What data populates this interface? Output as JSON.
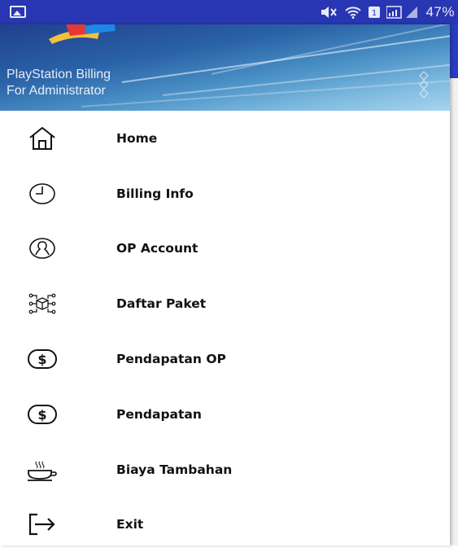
{
  "status_bar": {
    "battery_percent": "47%",
    "icons": [
      "gallery-icon",
      "mute-icon",
      "wifi-icon",
      "sim-icon",
      "signal-icon",
      "battery-icon"
    ]
  },
  "drawer": {
    "header": {
      "title_line1": "PlayStation Billing",
      "title_line2": "For Administrator",
      "gradient_colors": [
        "#21408d",
        "#4a91c6",
        "#a7d4ee"
      ]
    },
    "items": [
      {
        "label": "Home",
        "icon": "home-icon"
      },
      {
        "label": "Billing Info",
        "icon": "clock-icon"
      },
      {
        "label": "OP Account",
        "icon": "account-icon"
      },
      {
        "label": "Daftar Paket",
        "icon": "package-network-icon"
      },
      {
        "label": "Pendapatan OP",
        "icon": "dollar-icon"
      },
      {
        "label": "Pendapatan",
        "icon": "dollar-icon"
      },
      {
        "label": "Biaya Tambahan",
        "icon": "coffee-cup-icon"
      },
      {
        "label": "Exit",
        "icon": "exit-icon"
      }
    ]
  },
  "colors": {
    "status_bar": "#2836b3",
    "text": "#111111"
  }
}
